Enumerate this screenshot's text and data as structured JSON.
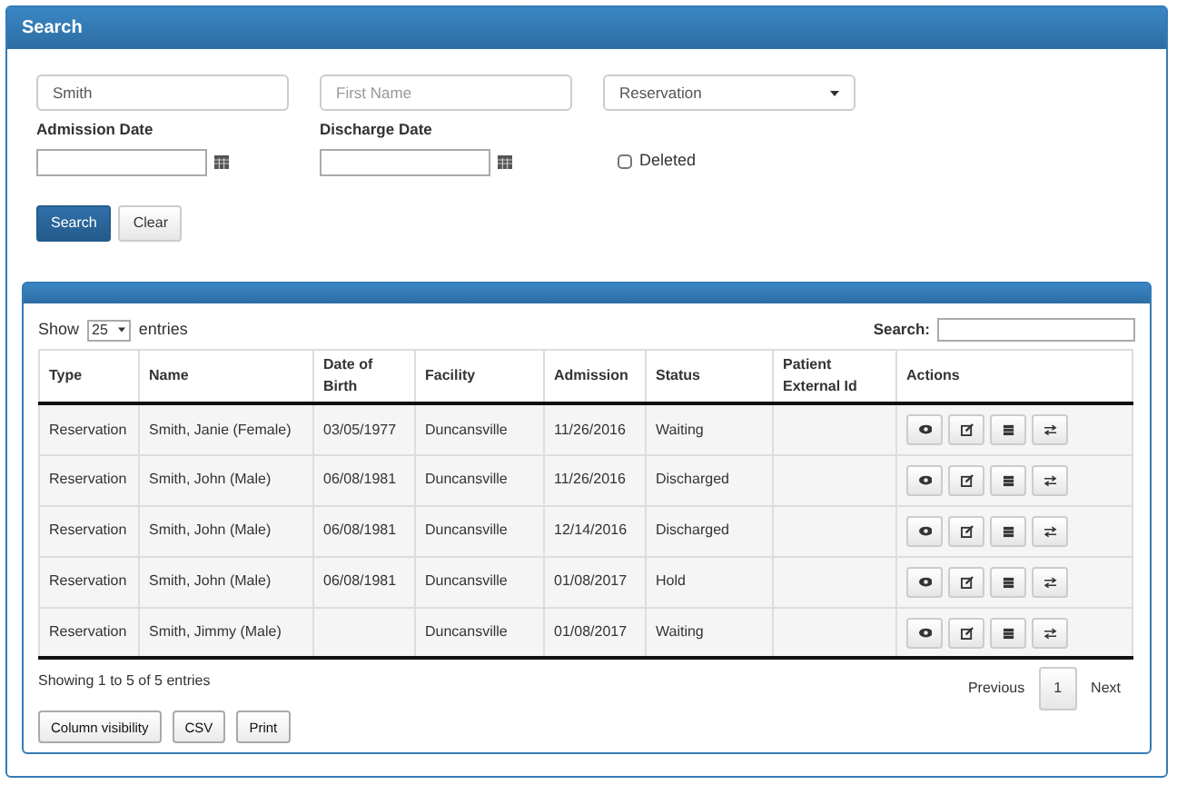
{
  "panel": {
    "title": "Search"
  },
  "form": {
    "last_name": {
      "value": "Smith"
    },
    "first_name": {
      "placeholder": "First Name"
    },
    "type_select": {
      "value": "Reservation"
    },
    "admission_date": {
      "label": "Admission Date"
    },
    "discharge_date": {
      "label": "Discharge Date"
    },
    "deleted": {
      "label": "Deleted",
      "checked": false
    },
    "buttons": [
      {
        "label": "Search",
        "kind": "primary"
      },
      {
        "label": "Clear",
        "kind": "default"
      }
    ]
  },
  "results": {
    "length": {
      "prefix": "Show",
      "value": "25",
      "suffix": "entries"
    },
    "search_label": "Search:",
    "table": {
      "columns": [
        "Type",
        "Name",
        "Date of Birth",
        "Facility",
        "Admission",
        "Status",
        "Patient External Id",
        "Actions"
      ],
      "rows": [
        [
          "Reservation",
          "Smith, Janie (Female)",
          "03/05/1977",
          "Duncansville",
          "11/26/2016",
          "Waiting",
          ""
        ],
        [
          "Reservation",
          "Smith, John (Male)",
          "06/08/1981",
          "Duncansville",
          "11/26/2016",
          "Discharged",
          ""
        ],
        [
          "Reservation",
          "Smith, John (Male)",
          "06/08/1981",
          "Duncansville",
          "12/14/2016",
          "Discharged",
          ""
        ],
        [
          "Reservation",
          "Smith, John (Male)",
          "06/08/1981",
          "Duncansville",
          "01/08/2017",
          "Hold",
          ""
        ],
        [
          "Reservation",
          "Smith, Jimmy (Male)",
          "",
          "Duncansville",
          "01/08/2017",
          "Waiting",
          ""
        ]
      ]
    },
    "info": "Showing 1 to 5 of 5 entries",
    "pagination": [
      {
        "label": "Previous",
        "selected": false
      },
      {
        "label": "1",
        "selected": true
      },
      {
        "label": "Next",
        "selected": false
      }
    ],
    "buttons": [
      "Column visibility",
      "CSV",
      "Print"
    ]
  }
}
